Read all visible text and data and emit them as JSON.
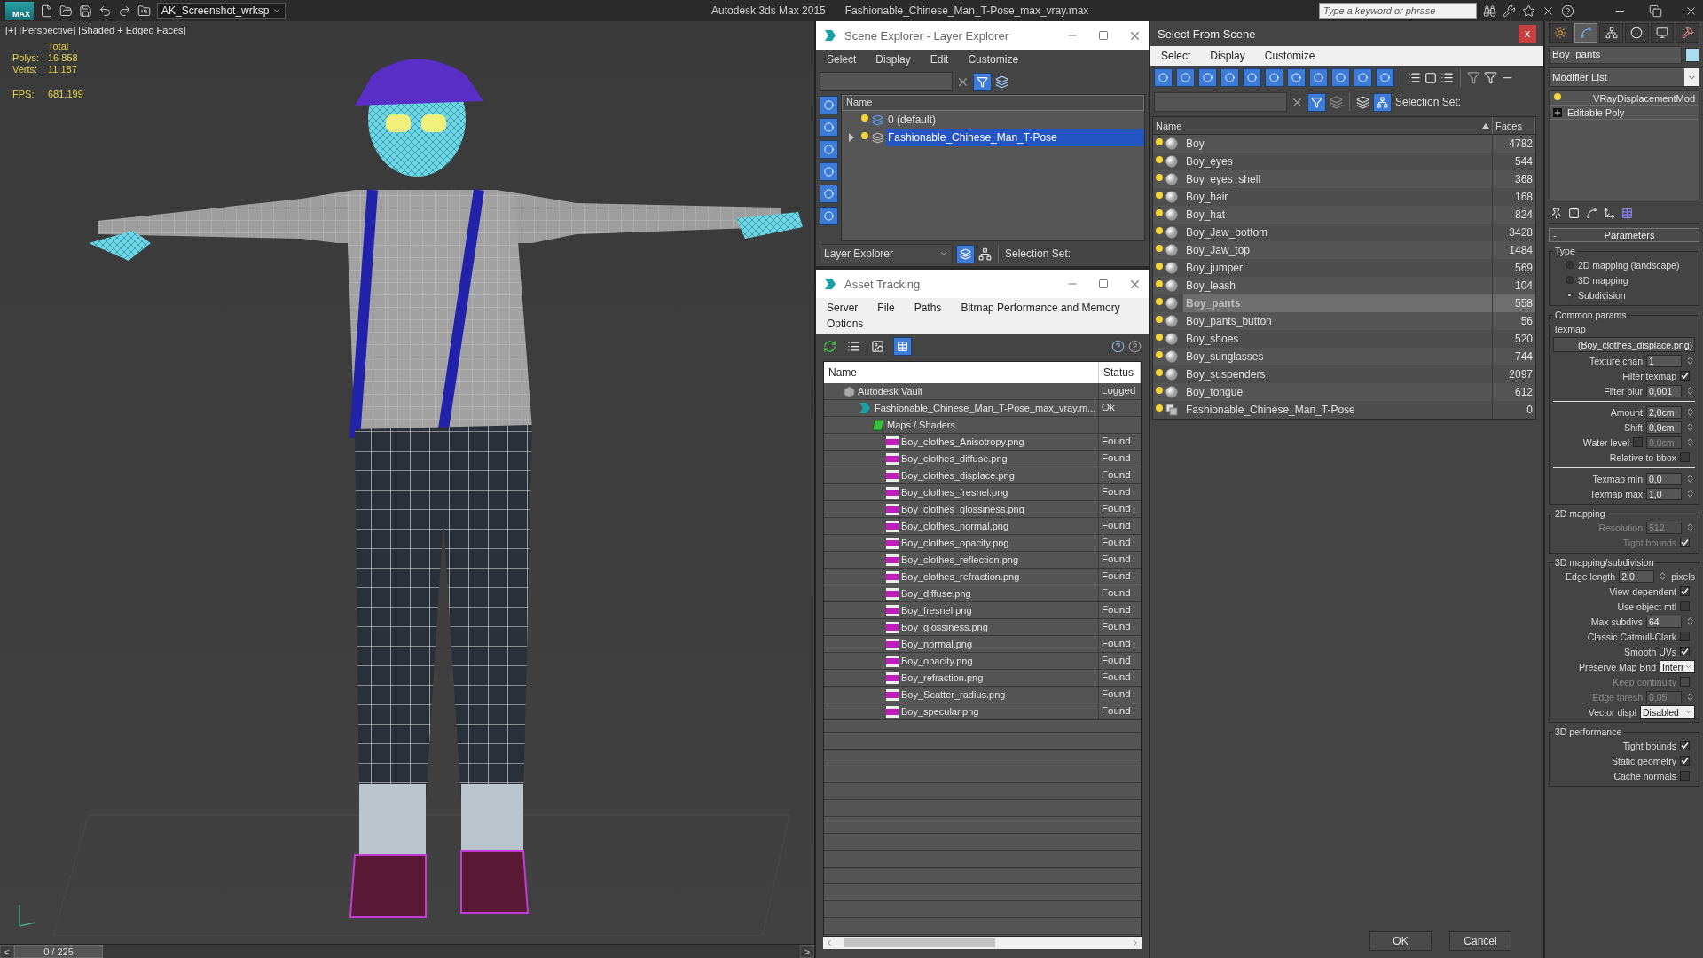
{
  "app": {
    "logo": "MAX",
    "workspace": "AK_Screenshot_wrksp",
    "title": "Autodesk 3ds Max  2015",
    "filename": "Fashionable_Chinese_Man_T-Pose_max_vray.max",
    "search": {
      "placeholder": "Type a keyword or phrase"
    }
  },
  "viewport": {
    "label": "[+] [Perspective] [Shaded + Edged Faces]",
    "stats": {
      "heading": "Total",
      "rows": [
        {
          "label": "Polys:",
          "value": "16 858"
        },
        {
          "label": "Verts:",
          "value": "11 187"
        }
      ],
      "fps": {
        "label": "FPS:",
        "value": "681,199"
      }
    }
  },
  "timeline": {
    "prev": "<",
    "frame": "0 / 225",
    "next": ">",
    "level": 0
  },
  "scene_explorer": {
    "title": "Scene Explorer - Layer Explorer",
    "menu": [
      "Select",
      "Display",
      "Edit",
      "Customize"
    ],
    "column": "Name",
    "layers": [
      {
        "name": "0 (default)",
        "selected": false,
        "expandable": false
      },
      {
        "name": "Fashionable_Chinese_Man_T-Pose",
        "selected": true,
        "expandable": true
      }
    ],
    "explorer_mode": "Layer Explorer",
    "selection_set_label": "Selection Set:"
  },
  "asset_tracking": {
    "title": "Asset Tracking",
    "menu": [
      "Server",
      "File",
      "Paths",
      "Bitmap Performance and Memory",
      "Options"
    ],
    "columns": [
      "Name",
      "Status"
    ],
    "tree": [
      {
        "kind": "vault",
        "name": "Autodesk Vault",
        "status": "Logged",
        "children": [
          {
            "kind": "scene",
            "name": "Fashionable_Chinese_Man_T-Pose_max_vray.m...",
            "status": "Ok",
            "children": [
              {
                "kind": "folder",
                "name": "Maps / Shaders",
                "children": [
                  {
                    "kind": "png",
                    "name": "Boy_clothes_Anisotropy.png",
                    "status": "Found"
                  },
                  {
                    "kind": "png",
                    "name": "Boy_clothes_diffuse.png",
                    "status": "Found"
                  },
                  {
                    "kind": "png",
                    "name": "Boy_clothes_displace.png",
                    "status": "Found"
                  },
                  {
                    "kind": "png",
                    "name": "Boy_clothes_fresnel.png",
                    "status": "Found"
                  },
                  {
                    "kind": "png",
                    "name": "Boy_clothes_glossiness.png",
                    "status": "Found"
                  },
                  {
                    "kind": "png",
                    "name": "Boy_clothes_normal.png",
                    "status": "Found"
                  },
                  {
                    "kind": "png",
                    "name": "Boy_clothes_opacity.png",
                    "status": "Found"
                  },
                  {
                    "kind": "png",
                    "name": "Boy_clothes_reflection.png",
                    "status": "Found"
                  },
                  {
                    "kind": "png",
                    "name": "Boy_clothes_refraction.png",
                    "status": "Found"
                  },
                  {
                    "kind": "png",
                    "name": "Boy_diffuse.png",
                    "status": "Found"
                  },
                  {
                    "kind": "png",
                    "name": "Boy_fresnel.png",
                    "status": "Found"
                  },
                  {
                    "kind": "png",
                    "name": "Boy_glossiness.png",
                    "status": "Found"
                  },
                  {
                    "kind": "png",
                    "name": "Boy_normal.png",
                    "status": "Found"
                  },
                  {
                    "kind": "png",
                    "name": "Boy_opacity.png",
                    "status": "Found"
                  },
                  {
                    "kind": "png",
                    "name": "Boy_refraction.png",
                    "status": "Found"
                  },
                  {
                    "kind": "png",
                    "name": "Boy_Scatter_radius.png",
                    "status": "Found"
                  },
                  {
                    "kind": "png",
                    "name": "Boy_specular.png",
                    "status": "Found"
                  }
                ]
              }
            ]
          }
        ]
      }
    ]
  },
  "select_from_scene": {
    "title": "Select From Scene",
    "close": "x",
    "menu": [
      "Select",
      "Display",
      "Customize"
    ],
    "selection_set_label": "Selection Set:",
    "columns": [
      "Name",
      "Faces"
    ],
    "rows": [
      {
        "kind": "mesh",
        "name": "Boy",
        "faces": "4782",
        "selected": false
      },
      {
        "kind": "mesh",
        "name": "Boy_eyes",
        "faces": "544",
        "selected": false
      },
      {
        "kind": "mesh",
        "name": "Boy_eyes_shell",
        "faces": "368",
        "selected": false
      },
      {
        "kind": "mesh",
        "name": "Boy_hair",
        "faces": "168",
        "selected": false
      },
      {
        "kind": "mesh",
        "name": "Boy_hat",
        "faces": "824",
        "selected": false
      },
      {
        "kind": "mesh",
        "name": "Boy_Jaw_bottom",
        "faces": "3428",
        "selected": false
      },
      {
        "kind": "mesh",
        "name": "Boy_Jaw_top",
        "faces": "1484",
        "selected": false
      },
      {
        "kind": "mesh",
        "name": "Boy_jumper",
        "faces": "569",
        "selected": false
      },
      {
        "kind": "mesh",
        "name": "Boy_leash",
        "faces": "104",
        "selected": false
      },
      {
        "kind": "mesh",
        "name": "Boy_pants",
        "faces": "558",
        "selected": true
      },
      {
        "kind": "mesh",
        "name": "Boy_pants_button",
        "faces": "56",
        "selected": false
      },
      {
        "kind": "mesh",
        "name": "Boy_shoes",
        "faces": "520",
        "selected": false
      },
      {
        "kind": "mesh",
        "name": "Boy_sunglasses",
        "faces": "744",
        "selected": false
      },
      {
        "kind": "mesh",
        "name": "Boy_suspenders",
        "faces": "2097",
        "selected": false
      },
      {
        "kind": "mesh",
        "name": "Boy_tongue",
        "faces": "612",
        "selected": false
      },
      {
        "kind": "group",
        "name": "Fashionable_Chinese_Man_T-Pose",
        "faces": "0",
        "selected": false
      }
    ],
    "buttons": [
      "OK",
      "Cancel"
    ]
  },
  "command_panel": {
    "tabs": [
      {
        "kind": "create",
        "selected": false
      },
      {
        "kind": "modify",
        "selected": true
      },
      {
        "kind": "hierarchy",
        "selected": false
      },
      {
        "kind": "motion",
        "selected": false
      },
      {
        "kind": "display",
        "selected": false
      },
      {
        "kind": "utilities",
        "selected": false
      }
    ],
    "object_name": "Boy_pants",
    "modifier_list": "Modifier List",
    "stack": [
      {
        "kind": "modifier",
        "name": "VRayDisplacementMod"
      },
      {
        "kind": "base",
        "name": "Editable Poly"
      }
    ],
    "rollout": {
      "toggle": "-",
      "title": "Parameters"
    },
    "type_group": {
      "title": "Type",
      "options": [
        {
          "label": "2D mapping (landscape)",
          "selected": false
        },
        {
          "label": "3D mapping",
          "selected": false
        },
        {
          "label": "Subdivision",
          "selected": true
        }
      ]
    },
    "groups": [
      {
        "title": "Common params",
        "rows": [
          {
            "kind": "label",
            "label": "Texmap"
          },
          {
            "kind": "map_button",
            "value": "(Boy_clothes_displace.png)"
          },
          {
            "kind": "spinner",
            "label": "Texture chan",
            "value": "1",
            "disabled": false
          },
          {
            "kind": "checkbox",
            "label": "Filter texmap",
            "checked": true,
            "disabled": false
          },
          {
            "kind": "spinner",
            "label": "Filter blur",
            "value": "0,001",
            "disabled": false
          },
          {
            "kind": "divider"
          },
          {
            "kind": "spinner",
            "label": "Amount",
            "value": "2,0cm",
            "disabled": false
          },
          {
            "kind": "spinner",
            "label": "Shift",
            "value": "0,0cm",
            "disabled": false
          },
          {
            "kind": "check_spinner",
            "label": "Water level",
            "checked": false,
            "value": "0,0cm",
            "disabled": true
          },
          {
            "kind": "checkbox",
            "label": "Relative to bbox",
            "checked": false,
            "disabled": false
          },
          {
            "kind": "divider"
          },
          {
            "kind": "spinner",
            "label": "Texmap min",
            "value": "0,0",
            "disabled": false
          },
          {
            "kind": "spinner",
            "label": "Texmap max",
            "value": "1,0",
            "disabled": false
          }
        ]
      },
      {
        "title": "2D mapping",
        "rows": [
          {
            "kind": "spinner",
            "label": "Resolution",
            "value": "512",
            "disabled": true
          },
          {
            "kind": "checkbox",
            "label": "Tight bounds",
            "checked": true,
            "disabled": true
          }
        ]
      },
      {
        "title": "3D mapping/subdivision",
        "rows": [
          {
            "kind": "spinner",
            "label": "Edge length",
            "value": "2,0",
            "unit": "pixels",
            "disabled": false
          },
          {
            "kind": "checkbox",
            "label": "View-dependent",
            "checked": true,
            "disabled": false
          },
          {
            "kind": "checkbox",
            "label": "Use object mtl",
            "checked": false,
            "disabled": false
          },
          {
            "kind": "spinner",
            "label": "Max subdivs",
            "value": "64",
            "disabled": false
          },
          {
            "kind": "checkbox",
            "label": "Classic Catmull-Clark",
            "checked": false,
            "disabled": false
          },
          {
            "kind": "checkbox",
            "label": "Smooth UVs",
            "checked": true,
            "disabled": false
          },
          {
            "kind": "dropdown",
            "label": "Preserve Map Bnd",
            "value": "Interr"
          },
          {
            "kind": "checkbox",
            "label": "Keep continuity",
            "checked": false,
            "disabled": true
          },
          {
            "kind": "spinner",
            "label": "Edge thresh",
            "value": "0,05",
            "disabled": true
          },
          {
            "kind": "dropdown",
            "label": "Vector displ",
            "value": "Disabled"
          }
        ]
      },
      {
        "title": "3D performance",
        "rows": [
          {
            "kind": "checkbox",
            "label": "Tight bounds",
            "checked": true,
            "disabled": false
          },
          {
            "kind": "checkbox",
            "label": "Static geometry",
            "checked": true,
            "disabled": false
          },
          {
            "kind": "checkbox",
            "label": "Cache normals",
            "checked": false,
            "disabled": false
          }
        ]
      }
    ]
  }
}
